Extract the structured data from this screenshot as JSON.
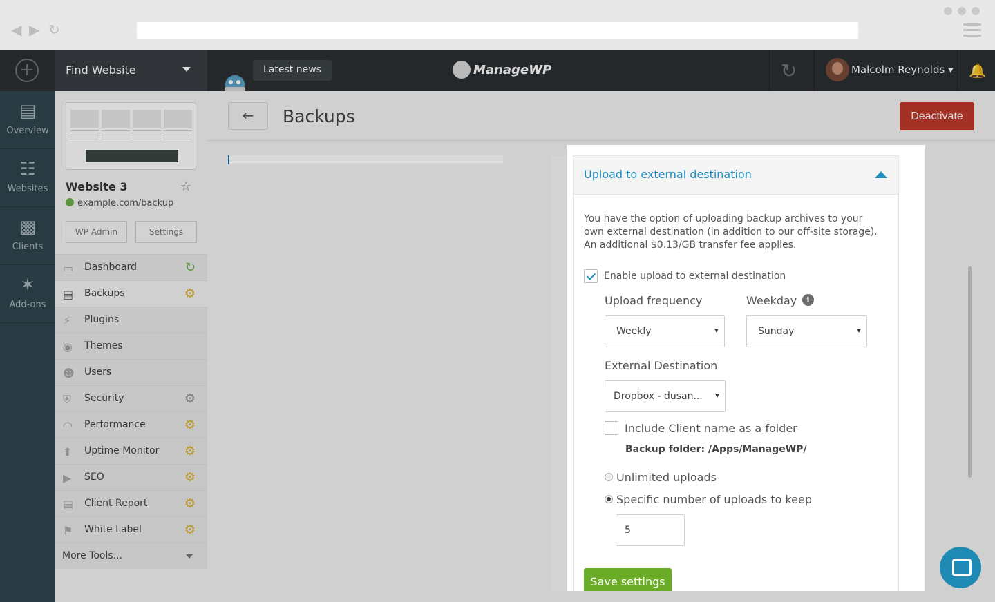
{
  "app": {
    "find_website": "Find Website",
    "latest_news": "Latest news",
    "logo_text": "ManageWP",
    "user_name": "Malcolm Reynolds"
  },
  "rail": [
    {
      "label": "Overview",
      "icon": "chart-icon"
    },
    {
      "label": "Websites",
      "icon": "websites-icon"
    },
    {
      "label": "Clients",
      "icon": "clients-icon"
    },
    {
      "label": "Add-ons",
      "icon": "addons-icon"
    }
  ],
  "site": {
    "name": "Website 3",
    "url": "example.com/backup",
    "wp_admin": "WP Admin",
    "settings": "Settings"
  },
  "menu": [
    {
      "label": "Dashboard",
      "icon": "monitor-icon",
      "badge": "refresh"
    },
    {
      "label": "Backups",
      "icon": "backup-icon",
      "badge": "gear-yellow"
    },
    {
      "label": "Plugins",
      "icon": "plug-icon",
      "badge": ""
    },
    {
      "label": "Themes",
      "icon": "palette-icon",
      "badge": ""
    },
    {
      "label": "Users",
      "icon": "user-icon",
      "badge": ""
    },
    {
      "label": "Security",
      "icon": "shield-icon",
      "badge": "gear-grey"
    },
    {
      "label": "Performance",
      "icon": "gauge-icon",
      "badge": "gear-yellow"
    },
    {
      "label": "Uptime Monitor",
      "icon": "arrow-up-icon",
      "badge": "gear-yellow"
    },
    {
      "label": "SEO",
      "icon": "megaphone-icon",
      "badge": "gear-yellow"
    },
    {
      "label": "Client Report",
      "icon": "report-icon",
      "badge": "gear-yellow"
    },
    {
      "label": "White Label",
      "icon": "tag-icon",
      "badge": "gear-yellow"
    }
  ],
  "more_tools": "More Tools...",
  "page": {
    "title": "Backups",
    "deactivate": "Deactivate",
    "progress_fraction": 0.005
  },
  "modal": {
    "title": "Upload to external destination",
    "description": "You have the option of uploading backup archives to your own external destination (in addition to our off-site storage). An additional $0.13/GB transfer fee applies.",
    "enable_label": "Enable upload to external destination",
    "enable_checked": true,
    "frequency_label": "Upload frequency",
    "frequency_value": "Weekly",
    "weekday_label": "Weekday",
    "weekday_value": "Sunday",
    "destination_label": "External Destination",
    "destination_value": "Dropbox - dusan...",
    "include_client_label": "Include Client name as a folder",
    "include_client_checked": false,
    "backup_folder": "Backup folder: /Apps/ManageWP/",
    "unlimited_label": "Unlimited uploads",
    "specific_label": "Specific number of uploads to keep",
    "specific_selected": true,
    "uploads_to_keep": "5",
    "save_label": "Save settings"
  },
  "colors": {
    "accent": "#1c8ebf",
    "deactivate": "#c0392b",
    "save": "#6aab27",
    "gear": "#e2b428",
    "rail": "#2f464f",
    "topbar": "#2b2f33"
  }
}
